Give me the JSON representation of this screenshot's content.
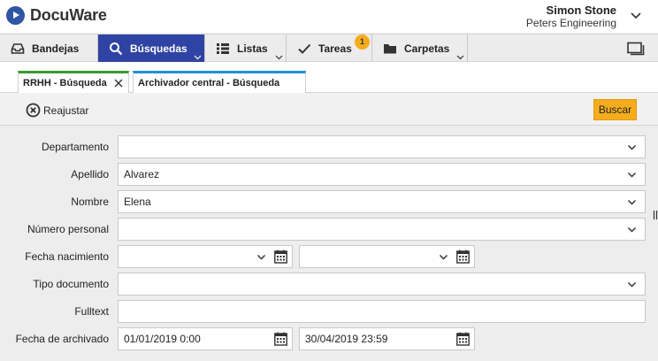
{
  "app": {
    "name": "DocuWare"
  },
  "user": {
    "name": "Simon Stone",
    "company": "Peters Engineering"
  },
  "nav": {
    "items": [
      {
        "label": "Bandejas",
        "icon": "inbox-icon"
      },
      {
        "label": "Búsquedas",
        "icon": "search-icon",
        "active": true
      },
      {
        "label": "Listas",
        "icon": "list-icon"
      },
      {
        "label": "Tareas",
        "icon": "checkmark-icon",
        "badge": "1"
      },
      {
        "label": "Carpetas",
        "icon": "folder-icon"
      }
    ]
  },
  "tabs": [
    {
      "label": "RRHH - Búsqueda",
      "active": true
    },
    {
      "label": "Archivador central - Búsqueda"
    }
  ],
  "toolbar": {
    "reset_label": "Reajustar",
    "search_label": "Buscar"
  },
  "form": {
    "departamento": {
      "label": "Departamento",
      "value": ""
    },
    "apellido": {
      "label": "Apellido",
      "value": "Alvarez"
    },
    "nombre": {
      "label": "Nombre",
      "value": "Elena"
    },
    "numero_personal": {
      "label": "Número personal",
      "value": ""
    },
    "fecha_nacimiento": {
      "label": "Fecha nacimiento",
      "from": "",
      "to": ""
    },
    "tipo_documento": {
      "label": "Tipo documento",
      "value": ""
    },
    "fulltext": {
      "label": "Fulltext",
      "value": ""
    },
    "fecha_archivado": {
      "label": "Fecha de archivado",
      "from": "01/01/2019 0:00",
      "to": "30/04/2019 23:59"
    }
  },
  "colors": {
    "accent": "#2f43a4",
    "search_button": "#f5ad1d",
    "badge": "#f5ad1d",
    "tab1_accent": "#3a9a2e",
    "tab2_accent": "#1f8fd6"
  }
}
